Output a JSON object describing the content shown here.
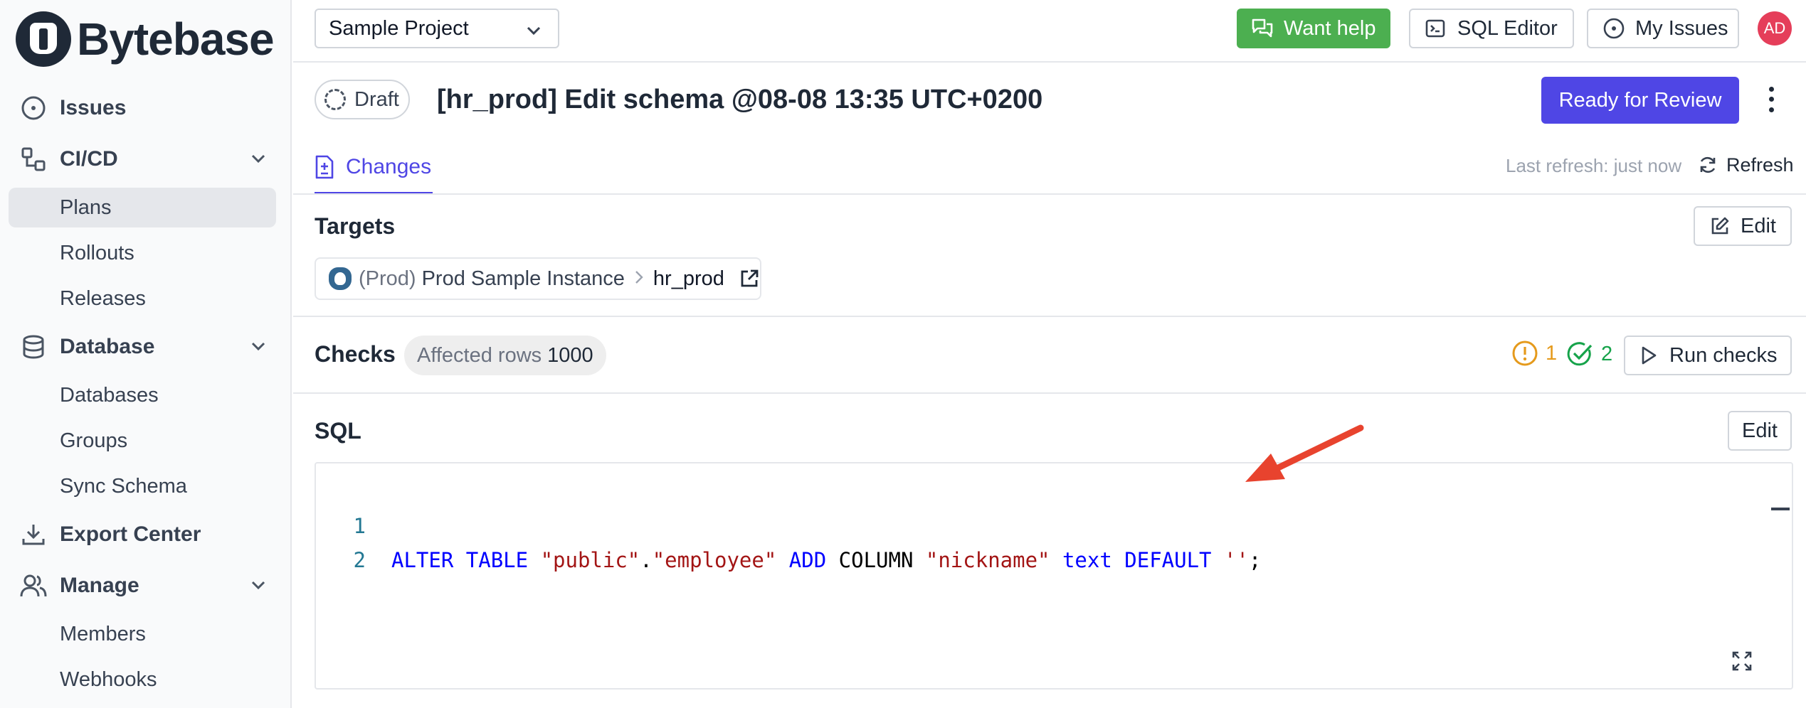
{
  "brand": {
    "name": "Bytebase"
  },
  "sidebar": {
    "items": [
      {
        "label": "Issues"
      },
      {
        "label": "CI/CD"
      },
      {
        "label": "Database"
      },
      {
        "label": "Export Center"
      },
      {
        "label": "Manage"
      }
    ],
    "cicd_children": [
      "Plans",
      "Rollouts",
      "Releases"
    ],
    "database_children": [
      "Databases",
      "Groups",
      "Sync Schema"
    ],
    "manage_children": [
      "Members",
      "Webhooks"
    ],
    "active": "Plans"
  },
  "header": {
    "project": "Sample Project",
    "want_help": "Want help",
    "sql_editor": "SQL Editor",
    "my_issues": "My Issues",
    "avatar_initials": "AD"
  },
  "plan": {
    "status": "Draft",
    "title": "[hr_prod] Edit schema @08-08 13:35 UTC+0200",
    "ready_button": "Ready for Review"
  },
  "tabs": {
    "changes": "Changes",
    "last_refresh": "Last refresh: just now",
    "refresh": "Refresh"
  },
  "targets": {
    "title": "Targets",
    "edit": "Edit",
    "environment": "(Prod)",
    "instance": "Prod Sample Instance",
    "database": "hr_prod"
  },
  "checks": {
    "title": "Checks",
    "affected_label": "Affected rows",
    "affected_value": "1000",
    "warning_count": "1",
    "success_count": "2",
    "run": "Run checks"
  },
  "sql": {
    "title": "SQL",
    "edit": "Edit",
    "line_numbers": [
      "1",
      "2"
    ],
    "tokens": {
      "alter": "ALTER",
      "table": "TABLE",
      "schema": "\"public\"",
      "dot": ".",
      "table_name": "\"employee\"",
      "add": "ADD",
      "column": "COLUMN",
      "column_name": "\"nickname\"",
      "type": "text",
      "default": "DEFAULT",
      "default_value": "''",
      "semicolon": ";"
    }
  },
  "colors": {
    "primary": "#4f46e5",
    "help_green": "#4caf50",
    "avatar": "#e53e5a",
    "warning": "#e59a1c",
    "success": "#16a34a",
    "annotation_arrow": "#e8432e"
  }
}
